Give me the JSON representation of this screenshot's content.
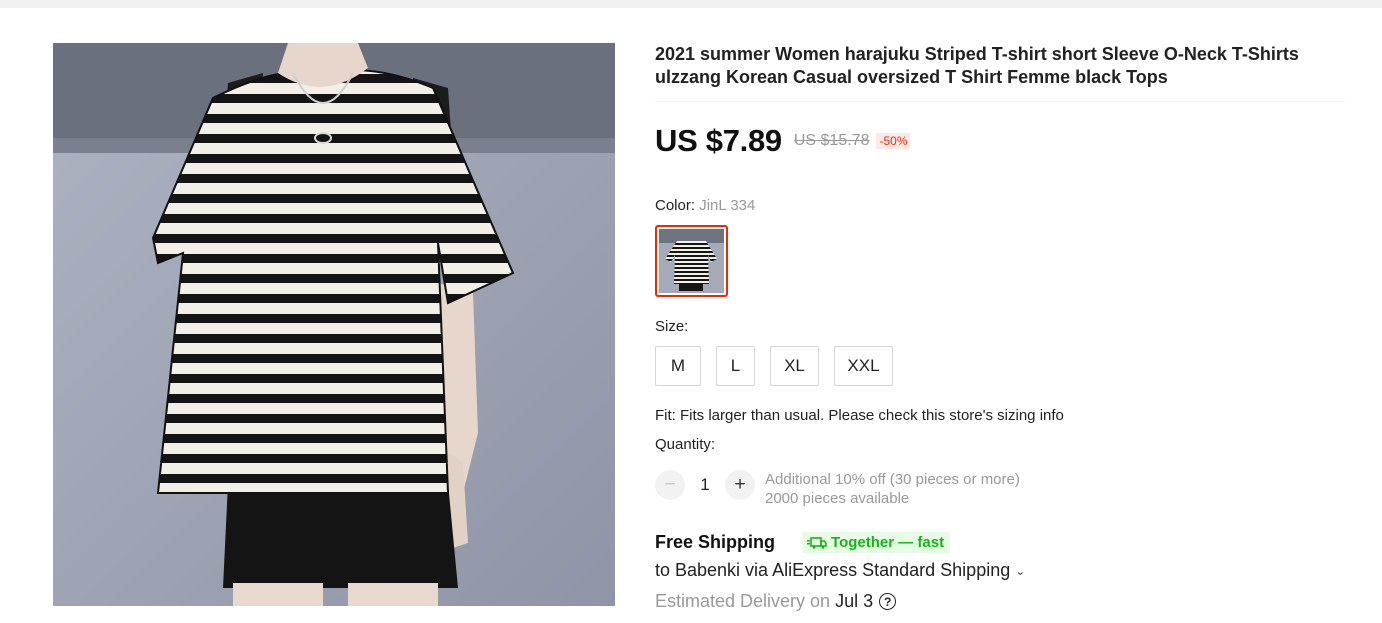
{
  "product": {
    "title": "2021 summer Women harajuku Striped T-shirt short Sleeve O-Neck T-Shirts ulzzang Korean Casual oversized T Shirt Femme black Tops",
    "price": {
      "current": "US $7.89",
      "original": "US $15.78",
      "discount": "-50%"
    },
    "color": {
      "label": "Color:",
      "selected": "JinL 334"
    },
    "size": {
      "label": "Size:",
      "options": [
        "M",
        "L",
        "XL",
        "XXL"
      ]
    },
    "fit": "Fit: Fits larger than usual. Please check this store's sizing info",
    "quantity": {
      "label": "Quantity:",
      "value": "1",
      "minus": "−",
      "plus": "+",
      "note_discount": "Additional 10% off (30 pieces or more)",
      "note_available": "2000 pieces available"
    },
    "shipping": {
      "title": "Free Shipping",
      "badge": "Together — fast",
      "method": "to Babenki via AliExpress Standard Shipping",
      "chevron": "⌄",
      "estimated_label": "Estimated Delivery on",
      "date": "Jul 3",
      "help": "?"
    }
  },
  "icons": {
    "help": "question-circle-icon",
    "badge": "delivery-truck-icon",
    "chevron": "chevron-down-icon"
  },
  "colors": {
    "accent": "#e62e04",
    "badge_green": "#17b31b",
    "badge_bg": "#e8fbe4",
    "muted": "#999999"
  }
}
